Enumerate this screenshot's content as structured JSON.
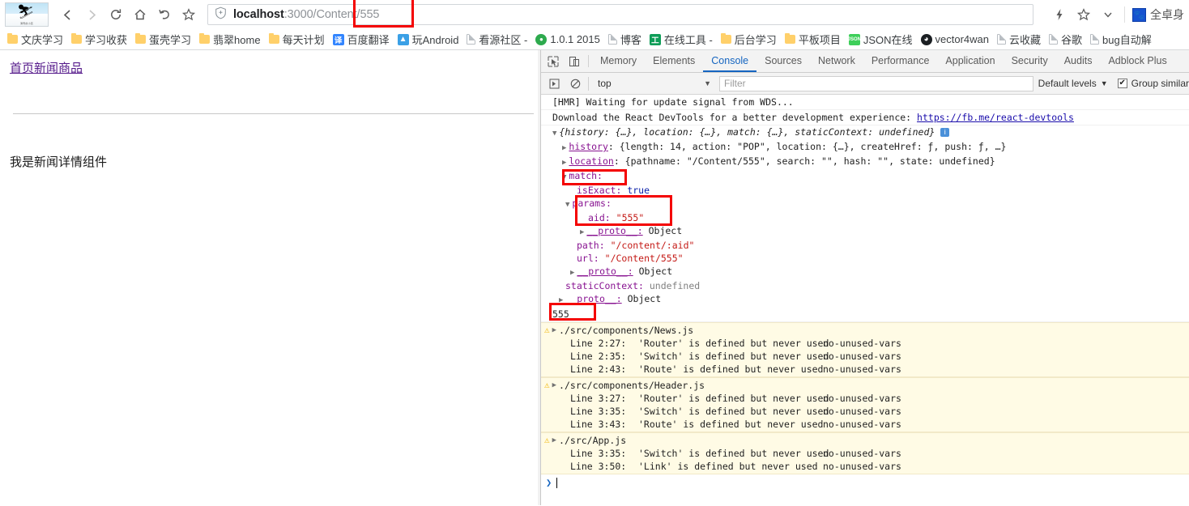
{
  "browser": {
    "profile_thumb_caption": "滑雪的小孩",
    "nav": [
      {
        "name": "back",
        "glyph": "‹"
      },
      {
        "name": "forward",
        "glyph": "›"
      },
      {
        "name": "reload",
        "glyph": "⟳"
      },
      {
        "name": "home",
        "glyph": "⌂"
      },
      {
        "name": "undo",
        "glyph": "↺"
      },
      {
        "name": "bookmark-star",
        "glyph": "☆"
      }
    ],
    "omnibox": {
      "shield_icon": "shield-icon",
      "host": "localhost",
      "path": ":3000/Content/555",
      "full_url": "localhost:3000/Content/555",
      "highlight_text": "/555"
    },
    "right_icons": [
      {
        "name": "lightning-icon",
        "glyph": "⚡"
      },
      {
        "name": "star-icon",
        "glyph": "☆"
      },
      {
        "name": "chevron-down-icon",
        "glyph": "⌄"
      }
    ],
    "extension": {
      "icon": "paw-icon",
      "icon_glyph": "🐾",
      "label": "全卓身"
    }
  },
  "bookmarks": [
    {
      "label": "文庆学习",
      "icon": "folder-icon",
      "type": "folder"
    },
    {
      "label": "学习收获",
      "icon": "folder-icon",
      "type": "folder"
    },
    {
      "label": "蛋壳学习",
      "icon": "folder-icon",
      "type": "folder"
    },
    {
      "label": "翡翠home",
      "icon": "folder-icon",
      "type": "folder"
    },
    {
      "label": "每天计划",
      "icon": "folder-icon",
      "type": "folder"
    },
    {
      "label": "百度翻译",
      "icon": "translate-icon",
      "type": "square",
      "glyph": "译",
      "color": "#3385ff"
    },
    {
      "label": "玩Android",
      "icon": "android-icon",
      "type": "square",
      "glyph": "🤖",
      "color": "#3ba0e6"
    },
    {
      "label": "看源社区 -",
      "icon": "page-icon",
      "type": "page"
    },
    {
      "label": "1.0.1 2015",
      "icon": "green-circle-icon",
      "type": "circle",
      "glyph": "◉",
      "color": "#2eaa4e"
    },
    {
      "label": "博客",
      "icon": "page-icon",
      "type": "page"
    },
    {
      "label": "在线工具 -",
      "icon": "tool-icon",
      "type": "square",
      "glyph": "工",
      "color": "#0f9d58"
    },
    {
      "label": "后台学习",
      "icon": "folder-icon",
      "type": "folder"
    },
    {
      "label": "平板项目",
      "icon": "folder-icon",
      "type": "folder"
    },
    {
      "label": "JSON在线",
      "icon": "json-icon",
      "type": "square",
      "glyph": "J",
      "color": "#3ecf5a"
    },
    {
      "label": "vector4wan",
      "icon": "github-icon",
      "type": "circle",
      "glyph": "",
      "color": "#1b1f23"
    },
    {
      "label": "云收藏",
      "icon": "page-icon",
      "type": "page"
    },
    {
      "label": "谷歌",
      "icon": "page-icon",
      "type": "page"
    },
    {
      "label": "bug自动解",
      "icon": "page-icon",
      "type": "page"
    }
  ],
  "page": {
    "nav_link": "首页新闻商品",
    "body_text": "我是新闻详情组件"
  },
  "devtools": {
    "icons": [
      {
        "name": "inspect-element-icon"
      },
      {
        "name": "device-toolbar-icon"
      }
    ],
    "tabs": [
      {
        "label": "Memory",
        "active": false
      },
      {
        "label": "Elements",
        "active": false
      },
      {
        "label": "Console",
        "active": true
      },
      {
        "label": "Sources",
        "active": false
      },
      {
        "label": "Network",
        "active": false
      },
      {
        "label": "Performance",
        "active": false
      },
      {
        "label": "Application",
        "active": false
      },
      {
        "label": "Security",
        "active": false
      },
      {
        "label": "Audits",
        "active": false
      },
      {
        "label": "Adblock Plus",
        "active": false
      }
    ],
    "filterbar": {
      "execute_icon": "execute-icon",
      "clear_icon": "clear-console-icon",
      "context": "top",
      "context_caret": "▼",
      "filter_placeholder": "Filter",
      "filter_value": "",
      "levels_label": "Default levels",
      "levels_caret": "▼",
      "group_similar_label": "Group similar",
      "group_similar_checked": true,
      "checkmark": "✔"
    },
    "console": {
      "hmr_message": "[HMR] Waiting for update signal from WDS...",
      "devtools_message": "Download the React DevTools for a better development experience: ",
      "devtools_link": "https://fb.me/react-devtools",
      "object_header": {
        "text": "{history: {…}, location: {…}, match: {…}, staticContext: undefined}",
        "triangle": "▼"
      },
      "history_line": {
        "key": "history",
        "value": "{length: 14, action: \"POP\", location: {…}, createHref: ƒ, push: ƒ, …}",
        "length_num": "14",
        "action_str": "\"POP\""
      },
      "location_line": {
        "key": "location",
        "value": "{pathname: \"/Content/555\", search: \"\", hash: \"\", state: undefined}",
        "pathname_str": "\"/Content/555\"",
        "search_str": "\"\"",
        "hash_str": "\"\"",
        "state_val": "undefined"
      },
      "match_key": "match:",
      "is_exact_key": "isExact:",
      "is_exact_val": "true",
      "params_key": "params:",
      "aid_key": "aid:",
      "aid_val": "\"555\"",
      "proto_key": "__proto__:",
      "proto_val": "Object",
      "path_key": "path:",
      "path_val": "\"/content/:aid\"",
      "url_key": "url:",
      "url_val": "\"/Content/555\"",
      "static_context_key": "staticContext:",
      "static_context_val": "undefined",
      "result_555": "555",
      "prompt_chevron": "❯"
    },
    "warnings": [
      {
        "file": "./src/components/News.js",
        "icon": "warning-icon",
        "triangle": "▶",
        "lines": [
          {
            "line": "Line 2:27:",
            "message": "'Router' is defined but never used",
            "rule": "no-unused-vars"
          },
          {
            "line": "Line 2:35:",
            "message": "'Switch' is defined but never used",
            "rule": "no-unused-vars"
          },
          {
            "line": "Line 2:43:",
            "message": "'Route' is defined but never used",
            "rule": "no-unused-vars"
          }
        ]
      },
      {
        "file": "./src/components/Header.js",
        "icon": "warning-icon",
        "triangle": "▶",
        "lines": [
          {
            "line": "Line 3:27:",
            "message": "'Router' is defined but never used",
            "rule": "no-unused-vars"
          },
          {
            "line": "Line 3:35:",
            "message": "'Switch' is defined but never used",
            "rule": "no-unused-vars"
          },
          {
            "line": "Line 3:43:",
            "message": "'Route' is defined but never used",
            "rule": "no-unused-vars"
          }
        ]
      },
      {
        "file": "./src/App.js",
        "icon": "warning-icon",
        "triangle": "▶",
        "lines": [
          {
            "line": "Line 3:35:",
            "message": "'Switch' is defined but never used",
            "rule": "no-unused-vars"
          },
          {
            "line": "Line 3:50:",
            "message": "'Link' is defined but never used",
            "rule": "no-unused-vars"
          }
        ]
      }
    ],
    "annotations": {
      "color": "#f40000",
      "boxes": [
        "url-555",
        "match",
        "params-aid",
        "result-555"
      ]
    }
  }
}
